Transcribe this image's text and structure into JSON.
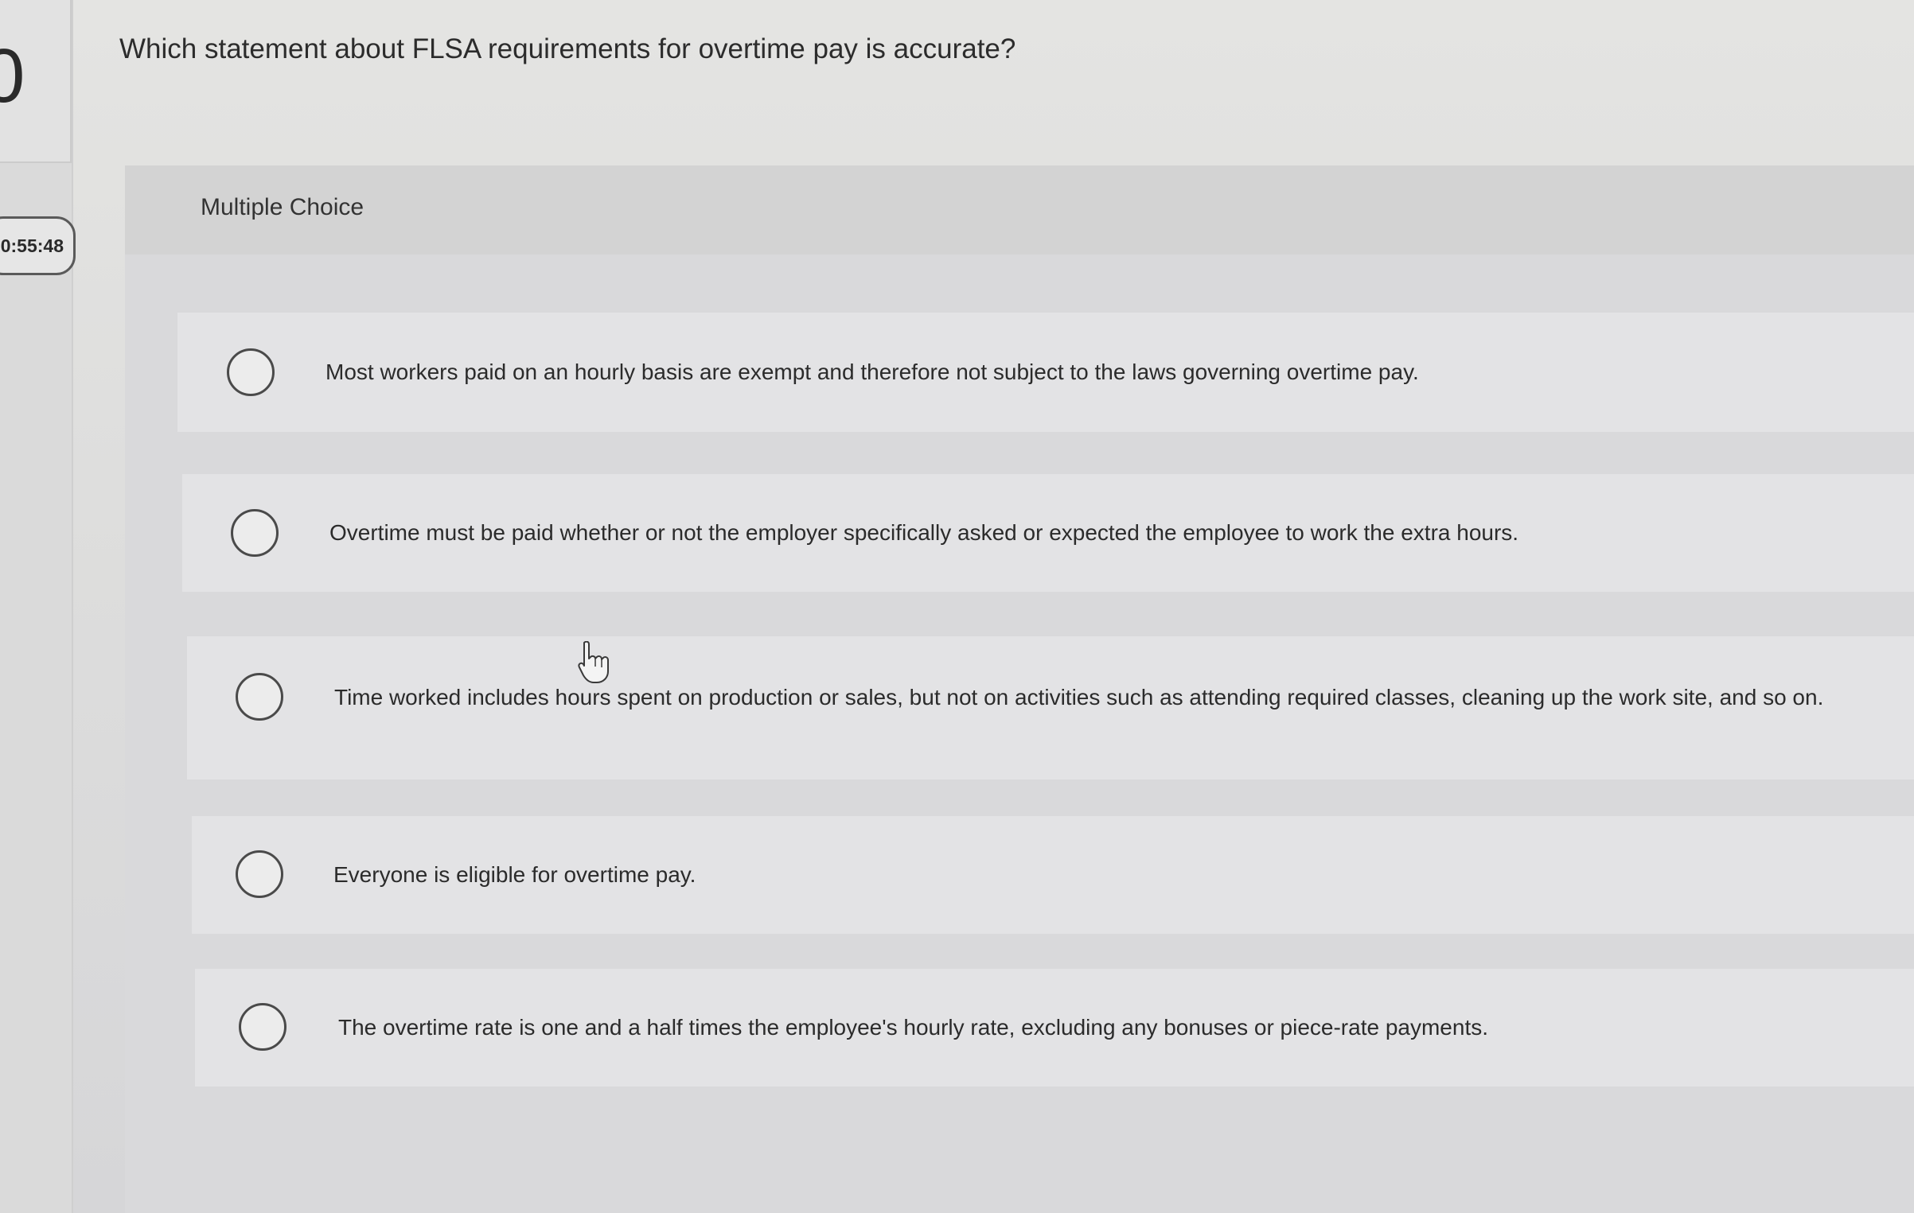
{
  "sidebar": {
    "question_number": "0",
    "timer": "0:55:48"
  },
  "question": {
    "text": "Which statement about FLSA requirements for overtime pay is accurate?"
  },
  "answer_panel": {
    "label": "Multiple Choice",
    "options": [
      {
        "text": "Most workers paid on an hourly basis are exempt and therefore not subject to the laws governing overtime pay.",
        "selected": false
      },
      {
        "text": "Overtime must be paid whether or not the employer specifically asked or expected the employee to work the extra hours.",
        "selected": false
      },
      {
        "text": "Time worked includes hours spent on production or sales, but not on activities such as attending required classes, cleaning up the work site, and so on.",
        "selected": false
      },
      {
        "text": "Everyone is eligible for overtime pay.",
        "selected": false
      },
      {
        "text": "The overtime rate is one and a half times the employee's hourly rate, excluding any bonuses or piece-rate payments.",
        "selected": false
      }
    ]
  },
  "icons": {
    "cursor": "hand-pointer-icon"
  }
}
